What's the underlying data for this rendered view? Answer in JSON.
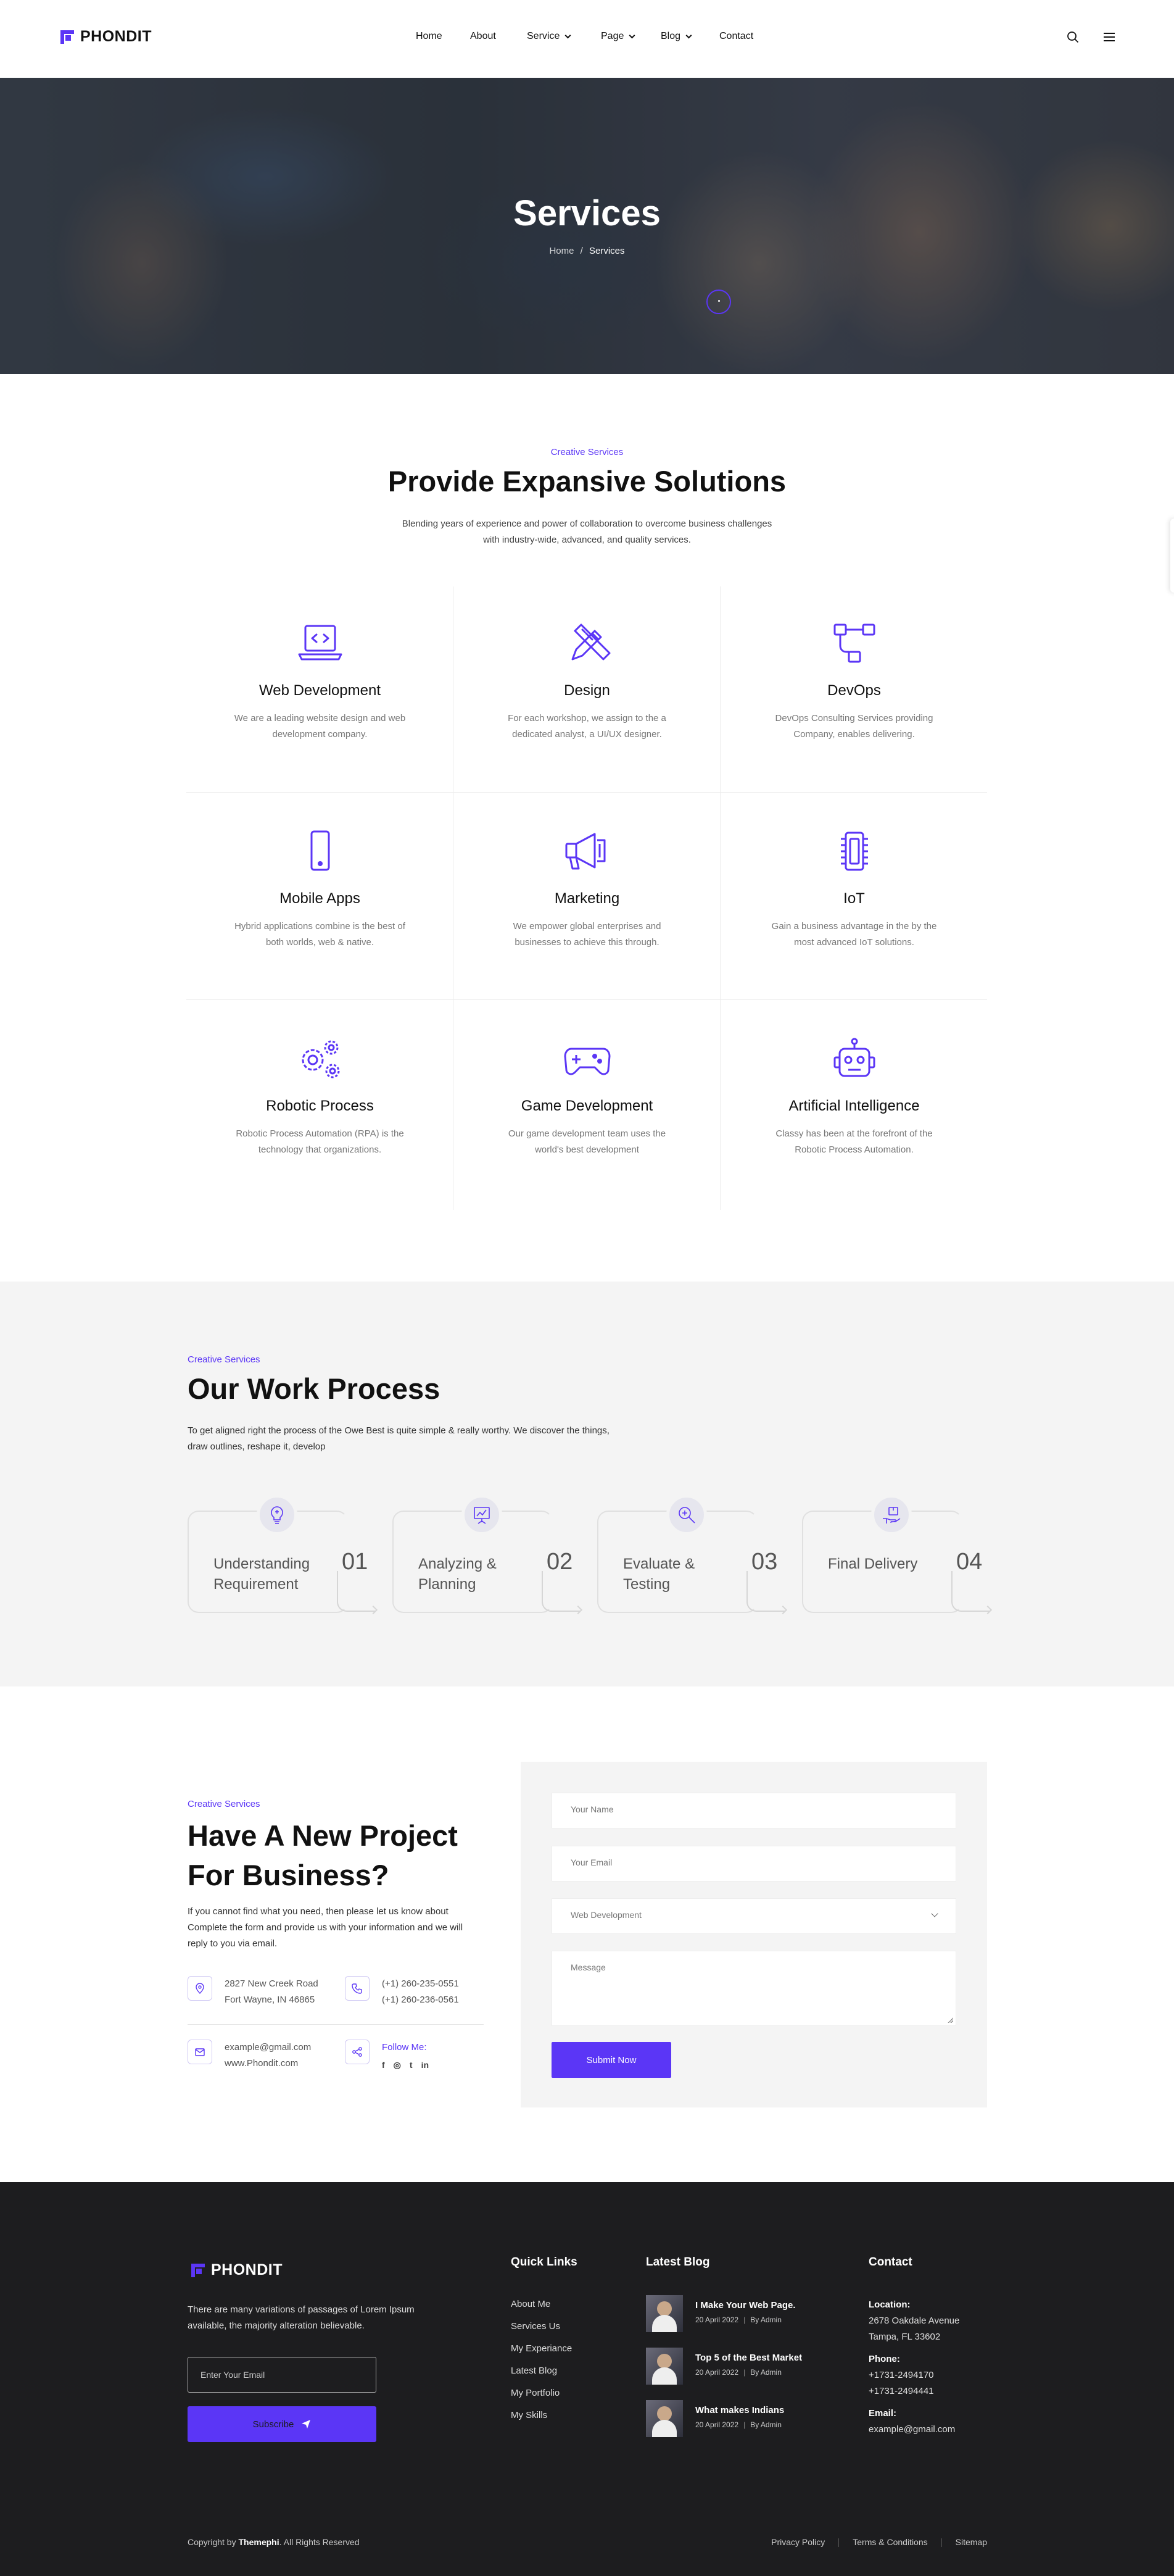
{
  "brand": {
    "name": "PHONDIT",
    "accent": "#5b36f6"
  },
  "nav": {
    "items": [
      {
        "label": "Home"
      },
      {
        "label": "About"
      },
      {
        "label": "Service"
      },
      {
        "label": "Page"
      },
      {
        "label": "Blog"
      },
      {
        "label": "Contact"
      }
    ]
  },
  "header_icons": [
    "search-icon",
    "menu-icon"
  ],
  "hero": {
    "title": "Services",
    "breadcrumb_home": "Home",
    "breadcrumb_sep": "/",
    "breadcrumb_current": "Services"
  },
  "services": {
    "tag": "Creative Services",
    "title": "Provide Expansive Solutions",
    "desc": "Blending years of experience and power of collaboration to overcome business challenges with industry-wide, advanced, and quality services.",
    "items": [
      {
        "title": "Web Development",
        "desc": "We are a leading website design and web development company.",
        "icon": "laptop-code-icon"
      },
      {
        "title": "Design",
        "desc": "For each workshop, we assign to the a dedicated analyst, a UI/UX designer.",
        "icon": "pencil-ruler-icon"
      },
      {
        "title": "DevOps",
        "desc": "DevOps Consulting Services providing Company, enables delivering.",
        "icon": "network-icon"
      },
      {
        "title": "Mobile Apps",
        "desc": "Hybrid applications combine is the best of both worlds, web & native.",
        "icon": "smartphone-icon"
      },
      {
        "title": "Marketing",
        "desc": "We empower global enterprises and businesses to achieve this through.",
        "icon": "megaphone-icon"
      },
      {
        "title": "IoT",
        "desc": "Gain a business advantage in the by the most advanced IoT solutions.",
        "icon": "chip-icon"
      },
      {
        "title": "Robotic Process",
        "desc": "Robotic Process Automation (RPA) is the technology that organizations.",
        "icon": "gears-icon"
      },
      {
        "title": "Game Development",
        "desc": "Our game development team uses the world's best development",
        "icon": "gamepad-icon"
      },
      {
        "title": "Artificial Intelligence",
        "desc": "Classy has been at the forefront of the Robotic Process Automation.",
        "icon": "robot-icon"
      }
    ]
  },
  "process": {
    "tag": "Creative Services",
    "title": "Our Work Process",
    "desc": "To get aligned right the process of the Owe Best is quite simple & really worthy. We discover the things, draw outlines, reshape it, develop",
    "steps": [
      {
        "label": "Understanding Requirement",
        "num": "01",
        "icon": "lightbulb-icon"
      },
      {
        "label": "Analyzing & Planning",
        "num": "02",
        "icon": "presentation-icon"
      },
      {
        "label": "Evaluate & Testing",
        "num": "03",
        "icon": "magnifier-icon"
      },
      {
        "label": "Final Delivery",
        "num": "04",
        "icon": "box-hand-icon"
      }
    ]
  },
  "contact": {
    "tag": "Creative Services",
    "title": "Have A New Project For Business?",
    "desc": "If you cannot find what you need, then please let us know about Complete the form and provide us with your information and we will reply to you via email.",
    "address_1": "2827 New Creek Road",
    "address_2": "Fort Wayne, IN 46865",
    "phone_1": "(+1) 260-235-0551",
    "phone_2": "(+1) 260-236-0561",
    "email": "example@gmail.com",
    "web": "www.Phondit.com",
    "follow": "Follow Me:",
    "social": [
      "f",
      "◎",
      "t",
      "in"
    ]
  },
  "form": {
    "name_ph": "Your Name",
    "email_ph": "Your Email",
    "service_selected": "Web Development",
    "message_ph": "Message",
    "submit": "Submit Now"
  },
  "footer": {
    "about": "There are many variations of passages of Lorem Ipsum available, the majority alteration believable.",
    "email_ph": "Enter Your Email",
    "subscribe": "Subscribe",
    "quick_title": "Quick Links",
    "quick": [
      "About Me",
      "Services Us",
      "My Experiance",
      "Latest Blog",
      "My Portfolio",
      "My Skills"
    ],
    "blog_title": "Latest Blog",
    "blog": [
      {
        "title": "I Make Your Web Page.",
        "date": "20 April 2022",
        "by": "By Admin"
      },
      {
        "title": "Top 5 of the Best Market",
        "date": "20 April 2022",
        "by": "By Admin"
      },
      {
        "title": "What makes Indians",
        "date": "20 April 2022",
        "by": "By Admin"
      }
    ],
    "contact_title": "Contact",
    "location_label": "Location:",
    "location_1": "2678 Oakdale Avenue",
    "location_2": "Tampa, FL 33602",
    "phone_label": "Phone:",
    "phone_1": "+1731-2494170",
    "phone_2": "+1731-2494441",
    "email_label": "Email:",
    "email": "example@gmail.com",
    "copyright_pre": "Copyright by",
    "copyright_brand": "Themephi",
    "copyright_post": ". All Rights Reserved",
    "bottom_links": [
      "Privacy Policy",
      "Terms & Conditions",
      "Sitemap"
    ]
  }
}
